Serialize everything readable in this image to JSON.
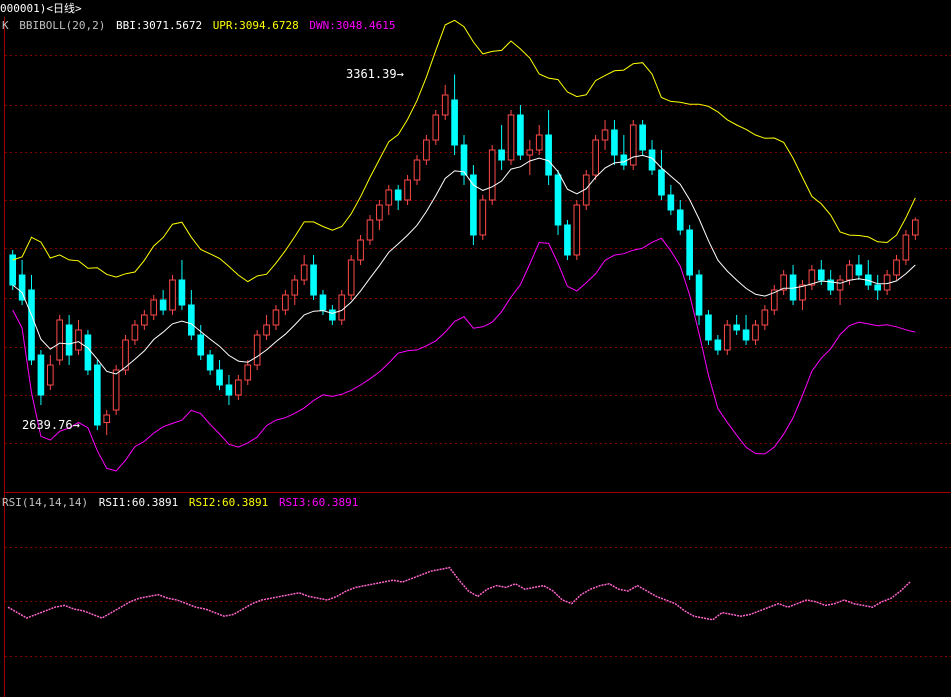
{
  "window": {
    "title": "000001)<日线>"
  },
  "main_panel": {
    "indicator_name": "K",
    "indicator_params": "BBIBOLL(20,2)",
    "bbi_label": "BBI:3071.5672",
    "upr_label": "UPR:3094.6728",
    "dwn_label": "DWN:3048.4615",
    "high_annotation": "3361.39",
    "low_annotation": "2639.76"
  },
  "rsi_panel": {
    "indicator_params": "RSI(14,14,14)",
    "rsi1_label": "RSI1:60.3891",
    "rsi2_label": "RSI2:60.3891",
    "rsi3_label": "RSI3:60.3891"
  },
  "colors": {
    "background": "#000000",
    "up_candle": "#ff4a4a",
    "down_candle": "#00ffff",
    "bbi_line": "#ffffff",
    "upr_line": "#ffff00",
    "dwn_line": "#ff00ff",
    "rsi_line": "#ff66cc",
    "grid": "#800000",
    "panel_border": "#a00000"
  },
  "chart_data": {
    "type": "candlestick",
    "instrument": "000001",
    "period": "日线",
    "ylim": [
      2550,
      3450
    ],
    "candles": [
      {
        "o": 3000,
        "h": 3010,
        "l": 2930,
        "c": 2940
      },
      {
        "o": 2960,
        "h": 2990,
        "l": 2900,
        "c": 2910
      },
      {
        "o": 2930,
        "h": 2960,
        "l": 2780,
        "c": 2790
      },
      {
        "o": 2800,
        "h": 2810,
        "l": 2700,
        "c": 2720
      },
      {
        "o": 2740,
        "h": 2800,
        "l": 2730,
        "c": 2780
      },
      {
        "o": 2790,
        "h": 2880,
        "l": 2780,
        "c": 2870
      },
      {
        "o": 2860,
        "h": 2880,
        "l": 2780,
        "c": 2800
      },
      {
        "o": 2810,
        "h": 2870,
        "l": 2800,
        "c": 2850
      },
      {
        "o": 2840,
        "h": 2850,
        "l": 2760,
        "c": 2770
      },
      {
        "o": 2780,
        "h": 2790,
        "l": 2650,
        "c": 2660
      },
      {
        "o": 2665,
        "h": 2690,
        "l": 2640,
        "c": 2680
      },
      {
        "o": 2690,
        "h": 2780,
        "l": 2680,
        "c": 2770
      },
      {
        "o": 2770,
        "h": 2840,
        "l": 2760,
        "c": 2830
      },
      {
        "o": 2830,
        "h": 2870,
        "l": 2820,
        "c": 2860
      },
      {
        "o": 2860,
        "h": 2890,
        "l": 2850,
        "c": 2880
      },
      {
        "o": 2880,
        "h": 2920,
        "l": 2870,
        "c": 2910
      },
      {
        "o": 2910,
        "h": 2930,
        "l": 2880,
        "c": 2890
      },
      {
        "o": 2890,
        "h": 2960,
        "l": 2880,
        "c": 2950
      },
      {
        "o": 2950,
        "h": 2990,
        "l": 2890,
        "c": 2900
      },
      {
        "o": 2900,
        "h": 2930,
        "l": 2830,
        "c": 2840
      },
      {
        "o": 2840,
        "h": 2860,
        "l": 2790,
        "c": 2800
      },
      {
        "o": 2800,
        "h": 2810,
        "l": 2760,
        "c": 2770
      },
      {
        "o": 2770,
        "h": 2790,
        "l": 2730,
        "c": 2740
      },
      {
        "o": 2740,
        "h": 2760,
        "l": 2700,
        "c": 2720
      },
      {
        "o": 2720,
        "h": 2760,
        "l": 2710,
        "c": 2750
      },
      {
        "o": 2750,
        "h": 2790,
        "l": 2740,
        "c": 2780
      },
      {
        "o": 2780,
        "h": 2850,
        "l": 2770,
        "c": 2840
      },
      {
        "o": 2840,
        "h": 2880,
        "l": 2830,
        "c": 2860
      },
      {
        "o": 2860,
        "h": 2900,
        "l": 2850,
        "c": 2890
      },
      {
        "o": 2890,
        "h": 2930,
        "l": 2880,
        "c": 2920
      },
      {
        "o": 2920,
        "h": 2960,
        "l": 2900,
        "c": 2950
      },
      {
        "o": 2950,
        "h": 3000,
        "l": 2940,
        "c": 2980
      },
      {
        "o": 2980,
        "h": 3000,
        "l": 2910,
        "c": 2920
      },
      {
        "o": 2920,
        "h": 2930,
        "l": 2880,
        "c": 2890
      },
      {
        "o": 2890,
        "h": 2900,
        "l": 2860,
        "c": 2870
      },
      {
        "o": 2870,
        "h": 2930,
        "l": 2860,
        "c": 2920
      },
      {
        "o": 2920,
        "h": 3000,
        "l": 2910,
        "c": 2990
      },
      {
        "o": 2990,
        "h": 3040,
        "l": 2980,
        "c": 3030
      },
      {
        "o": 3030,
        "h": 3080,
        "l": 3020,
        "c": 3070
      },
      {
        "o": 3070,
        "h": 3110,
        "l": 3050,
        "c": 3100
      },
      {
        "o": 3100,
        "h": 3140,
        "l": 3080,
        "c": 3130
      },
      {
        "o": 3130,
        "h": 3140,
        "l": 3090,
        "c": 3110
      },
      {
        "o": 3110,
        "h": 3160,
        "l": 3100,
        "c": 3150
      },
      {
        "o": 3150,
        "h": 3200,
        "l": 3140,
        "c": 3190
      },
      {
        "o": 3190,
        "h": 3240,
        "l": 3180,
        "c": 3230
      },
      {
        "o": 3230,
        "h": 3290,
        "l": 3220,
        "c": 3280
      },
      {
        "o": 3280,
        "h": 3340,
        "l": 3270,
        "c": 3320
      },
      {
        "o": 3310,
        "h": 3361,
        "l": 3200,
        "c": 3220
      },
      {
        "o": 3220,
        "h": 3240,
        "l": 3140,
        "c": 3160
      },
      {
        "o": 3160,
        "h": 3180,
        "l": 3020,
        "c": 3040
      },
      {
        "o": 3040,
        "h": 3120,
        "l": 3030,
        "c": 3110
      },
      {
        "o": 3110,
        "h": 3220,
        "l": 3100,
        "c": 3210
      },
      {
        "o": 3210,
        "h": 3260,
        "l": 3170,
        "c": 3190
      },
      {
        "o": 3190,
        "h": 3290,
        "l": 3180,
        "c": 3280
      },
      {
        "o": 3280,
        "h": 3300,
        "l": 3190,
        "c": 3200
      },
      {
        "o": 3200,
        "h": 3230,
        "l": 3160,
        "c": 3210
      },
      {
        "o": 3210,
        "h": 3260,
        "l": 3200,
        "c": 3240
      },
      {
        "o": 3240,
        "h": 3290,
        "l": 3140,
        "c": 3160
      },
      {
        "o": 3160,
        "h": 3170,
        "l": 3040,
        "c": 3060
      },
      {
        "o": 3060,
        "h": 3070,
        "l": 2990,
        "c": 3000
      },
      {
        "o": 3000,
        "h": 3110,
        "l": 2990,
        "c": 3100
      },
      {
        "o": 3100,
        "h": 3170,
        "l": 3090,
        "c": 3160
      },
      {
        "o": 3160,
        "h": 3240,
        "l": 3150,
        "c": 3230
      },
      {
        "o": 3230,
        "h": 3270,
        "l": 3210,
        "c": 3250
      },
      {
        "o": 3250,
        "h": 3270,
        "l": 3180,
        "c": 3200
      },
      {
        "o": 3200,
        "h": 3240,
        "l": 3170,
        "c": 3180
      },
      {
        "o": 3180,
        "h": 3270,
        "l": 3170,
        "c": 3260
      },
      {
        "o": 3260,
        "h": 3270,
        "l": 3200,
        "c": 3210
      },
      {
        "o": 3210,
        "h": 3230,
        "l": 3160,
        "c": 3170
      },
      {
        "o": 3170,
        "h": 3210,
        "l": 3110,
        "c": 3120
      },
      {
        "o": 3120,
        "h": 3140,
        "l": 3080,
        "c": 3090
      },
      {
        "o": 3090,
        "h": 3110,
        "l": 3040,
        "c": 3050
      },
      {
        "o": 3050,
        "h": 3060,
        "l": 2950,
        "c": 2960
      },
      {
        "o": 2960,
        "h": 2970,
        "l": 2860,
        "c": 2880
      },
      {
        "o": 2880,
        "h": 2890,
        "l": 2820,
        "c": 2830
      },
      {
        "o": 2830,
        "h": 2840,
        "l": 2800,
        "c": 2810
      },
      {
        "o": 2810,
        "h": 2870,
        "l": 2800,
        "c": 2860
      },
      {
        "o": 2860,
        "h": 2880,
        "l": 2840,
        "c": 2850
      },
      {
        "o": 2850,
        "h": 2880,
        "l": 2820,
        "c": 2830
      },
      {
        "o": 2830,
        "h": 2870,
        "l": 2820,
        "c": 2860
      },
      {
        "o": 2860,
        "h": 2900,
        "l": 2850,
        "c": 2890
      },
      {
        "o": 2890,
        "h": 2940,
        "l": 2880,
        "c": 2930
      },
      {
        "o": 2930,
        "h": 2970,
        "l": 2920,
        "c": 2960
      },
      {
        "o": 2960,
        "h": 2980,
        "l": 2900,
        "c": 2910
      },
      {
        "o": 2910,
        "h": 2950,
        "l": 2890,
        "c": 2940
      },
      {
        "o": 2940,
        "h": 2980,
        "l": 2930,
        "c": 2970
      },
      {
        "o": 2970,
        "h": 2990,
        "l": 2940,
        "c": 2950
      },
      {
        "o": 2950,
        "h": 2970,
        "l": 2920,
        "c": 2930
      },
      {
        "o": 2930,
        "h": 2960,
        "l": 2900,
        "c": 2950
      },
      {
        "o": 2950,
        "h": 2990,
        "l": 2940,
        "c": 2980
      },
      {
        "o": 2980,
        "h": 3000,
        "l": 2950,
        "c": 2960
      },
      {
        "o": 2960,
        "h": 2990,
        "l": 2930,
        "c": 2940
      },
      {
        "o": 2940,
        "h": 2960,
        "l": 2910,
        "c": 2930
      },
      {
        "o": 2930,
        "h": 2970,
        "l": 2920,
        "c": 2960
      },
      {
        "o": 2960,
        "h": 3000,
        "l": 2950,
        "c": 2990
      },
      {
        "o": 2990,
        "h": 3050,
        "l": 2980,
        "c": 3040
      },
      {
        "o": 3040,
        "h": 3075,
        "l": 3030,
        "c": 3070
      }
    ],
    "rsi": [
      46,
      43,
      40,
      42,
      44,
      46,
      47,
      45,
      44,
      42,
      40,
      43,
      46,
      49,
      51,
      52,
      53,
      51,
      50,
      48,
      46,
      45,
      43,
      41,
      42,
      45,
      48,
      50,
      51,
      52,
      53,
      54,
      52,
      51,
      50,
      52,
      55,
      57,
      58,
      59,
      60,
      61,
      60,
      62,
      64,
      66,
      67,
      68,
      61,
      55,
      52,
      56,
      58,
      57,
      59,
      56,
      57,
      58,
      55,
      50,
      48,
      53,
      56,
      58,
      59,
      56,
      55,
      58,
      55,
      52,
      50,
      48,
      44,
      41,
      40,
      39,
      43,
      42,
      41,
      42,
      44,
      46,
      48,
      46,
      48,
      50,
      49,
      47,
      48,
      50,
      48,
      47,
      46,
      49,
      51,
      55,
      60
    ],
    "rsi_ylim": [
      0,
      100
    ]
  }
}
